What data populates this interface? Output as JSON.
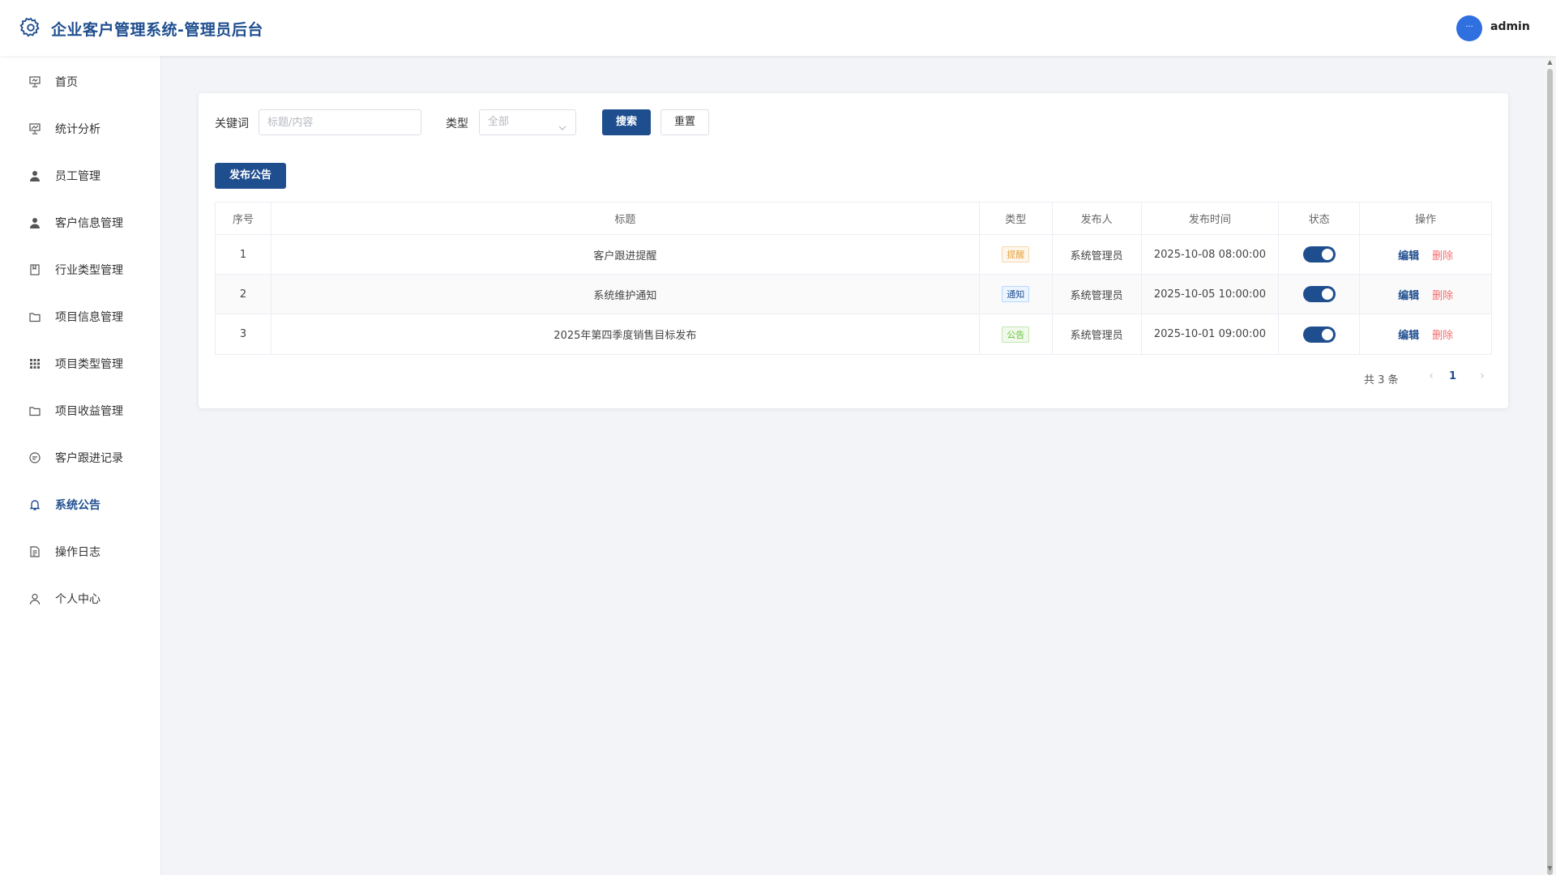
{
  "app": {
    "title": "企业客户管理系统-管理员后台"
  },
  "user": {
    "avatar_text": "···",
    "name": "admin"
  },
  "sidebar": {
    "items": [
      {
        "label": "首页",
        "icon": "presentation-icon"
      },
      {
        "label": "统计分析",
        "icon": "chart-icon"
      },
      {
        "label": "员工管理",
        "icon": "user-icon"
      },
      {
        "label": "客户信息管理",
        "icon": "user-icon"
      },
      {
        "label": "行业类型管理",
        "icon": "bookmark-icon"
      },
      {
        "label": "项目信息管理",
        "icon": "folder-icon"
      },
      {
        "label": "项目类型管理",
        "icon": "grid-icon"
      },
      {
        "label": "项目收益管理",
        "icon": "folder-icon"
      },
      {
        "label": "客户跟进记录",
        "icon": "chat-icon"
      },
      {
        "label": "系统公告",
        "icon": "bell-icon"
      },
      {
        "label": "操作日志",
        "icon": "document-icon"
      },
      {
        "label": "个人中心",
        "icon": "person-icon"
      }
    ],
    "active_index": 9
  },
  "filters": {
    "keyword_label": "关键词",
    "keyword_placeholder": "标题/内容",
    "keyword_value": "",
    "type_label": "类型",
    "type_value": "全部",
    "search_label": "搜索",
    "reset_label": "重置"
  },
  "publish_button": "发布公告",
  "table": {
    "headers": [
      "序号",
      "标题",
      "类型",
      "发布人",
      "发布时间",
      "状态",
      "操作"
    ],
    "rows": [
      {
        "index": "1",
        "title": "客户跟进提醒",
        "type": "提醒",
        "type_color": "#e6a23c",
        "type_bg": "#fdf6ec",
        "type_border": "#f5dab1",
        "publisher": "系统管理员",
        "time": "2025-10-08 08:00:00",
        "enabled": true
      },
      {
        "index": "2",
        "title": "系统维护通知",
        "type": "通知",
        "type_color": "#1f4e8f",
        "type_bg": "#ecf5ff",
        "type_border": "#b3d8ff",
        "publisher": "系统管理员",
        "time": "2025-10-05 10:00:00",
        "enabled": true
      },
      {
        "index": "3",
        "title": "2025年第四季度销售目标发布",
        "type": "公告",
        "type_color": "#67c23a",
        "type_bg": "#f0f9eb",
        "type_border": "#c2e7b0",
        "publisher": "系统管理员",
        "time": "2025-10-01 09:00:00",
        "enabled": true
      }
    ],
    "edit_label": "编辑",
    "delete_label": "删除"
  },
  "pagination": {
    "total_text": "共 3 条",
    "current_page": "1"
  }
}
